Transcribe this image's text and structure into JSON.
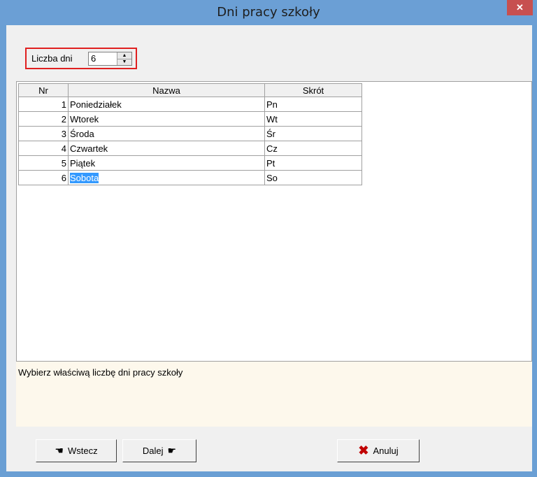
{
  "window": {
    "title": "Dni pracy szkoły",
    "close_glyph": "✕"
  },
  "days": {
    "label": "Liczba dni",
    "value": "6"
  },
  "table": {
    "headers": {
      "nr": "Nr",
      "name": "Nazwa",
      "abbr": "Skrót"
    },
    "rows": [
      {
        "nr": "1",
        "name": "Poniedziałek",
        "abbr": "Pn"
      },
      {
        "nr": "2",
        "name": "Wtorek",
        "abbr": "Wt"
      },
      {
        "nr": "3",
        "name": "Środa",
        "abbr": "Śr"
      },
      {
        "nr": "4",
        "name": "Czwartek",
        "abbr": "Cz"
      },
      {
        "nr": "5",
        "name": "Piątek",
        "abbr": "Pt"
      },
      {
        "nr": "6",
        "name": "Sobota",
        "abbr": "So"
      }
    ]
  },
  "hint": {
    "text": "Wybierz właściwą liczbę dni pracy szkoły"
  },
  "buttons": {
    "back": "Wstecz",
    "next": "Dalej",
    "cancel": "Anuluj"
  },
  "icons": {
    "back": "hand-pointing-left-icon",
    "next": "hand-pointing-right-icon",
    "cancel": "x-icon"
  },
  "colors": {
    "title_bar": "#6b9fd5",
    "close": "#c75050",
    "selection": "#3399ff",
    "hint_bg": "#fdf8ec",
    "highlight_border": "#e02020"
  }
}
